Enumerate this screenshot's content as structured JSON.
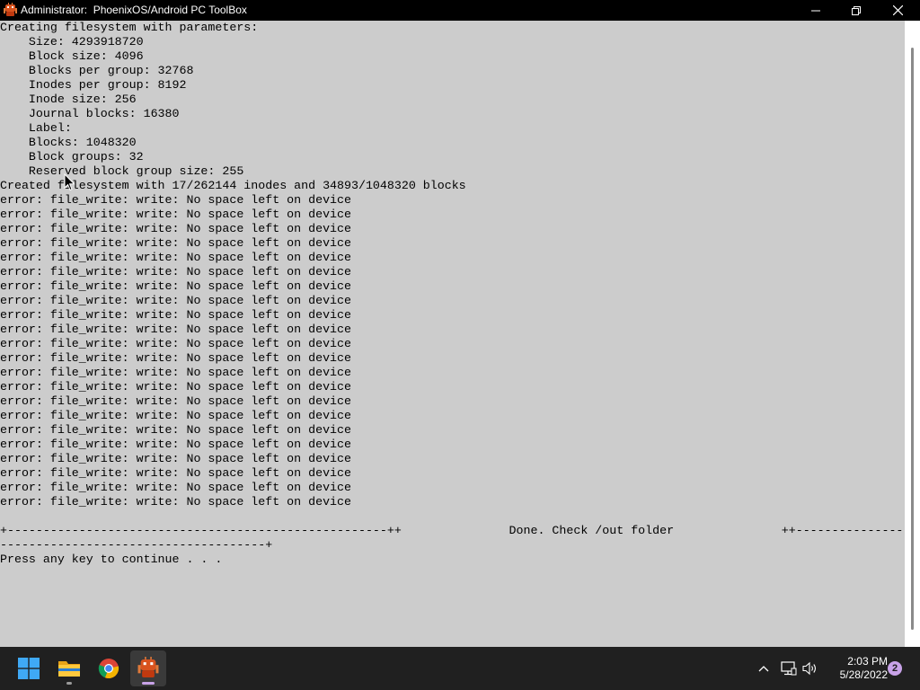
{
  "window": {
    "title": "Administrator:  PhoenixOS/Android PC ToolBox",
    "app_icon": "phoenixos-robot-icon",
    "controls": [
      "minimize-icon",
      "maximize-icon",
      "close-icon"
    ]
  },
  "console": {
    "lines": [
      "Creating filesystem with parameters:",
      "    Size: 4293918720",
      "    Block size: 4096",
      "    Blocks per group: 32768",
      "    Inodes per group: 8192",
      "    Inode size: 256",
      "    Journal blocks: 16380",
      "    Label:",
      "    Blocks: 1048320",
      "    Block groups: 32",
      "    Reserved block group size: 255",
      "Created filesystem with 17/262144 inodes and 34893/1048320 blocks",
      "error: file_write: write: No space left on device",
      "error: file_write: write: No space left on device",
      "error: file_write: write: No space left on device",
      "error: file_write: write: No space left on device",
      "error: file_write: write: No space left on device",
      "error: file_write: write: No space left on device",
      "error: file_write: write: No space left on device",
      "error: file_write: write: No space left on device",
      "error: file_write: write: No space left on device",
      "error: file_write: write: No space left on device",
      "error: file_write: write: No space left on device",
      "error: file_write: write: No space left on device",
      "error: file_write: write: No space left on device",
      "error: file_write: write: No space left on device",
      "error: file_write: write: No space left on device",
      "error: file_write: write: No space left on device",
      "error: file_write: write: No space left on device",
      "error: file_write: write: No space left on device",
      "error: file_write: write: No space left on device",
      "error: file_write: write: No space left on device",
      "error: file_write: write: No space left on device",
      "error: file_write: write: No space left on device",
      "",
      "+-----------------------------------------------------++               Done. Check /out folder               ++----------------",
      "-------------------------------------+",
      "Press any key to continue . . ."
    ],
    "background_color": "#cccccc",
    "text_color": "#000000"
  },
  "taskbar": {
    "apps": [
      {
        "name": "start-button",
        "icon": "windows-logo-icon"
      },
      {
        "name": "file-explorer",
        "icon": "folder-icon"
      },
      {
        "name": "chrome",
        "icon": "chrome-icon"
      },
      {
        "name": "phoenixos-toolbox",
        "icon": "phoenixos-robot-icon",
        "active": true
      }
    ],
    "tray": [
      "chevron-up-icon",
      "network-icon",
      "volume-icon"
    ],
    "clock": {
      "time": "2:03 PM",
      "date": "5/28/2022"
    },
    "notifications": "2",
    "accent_color": "#c8a2e8"
  }
}
